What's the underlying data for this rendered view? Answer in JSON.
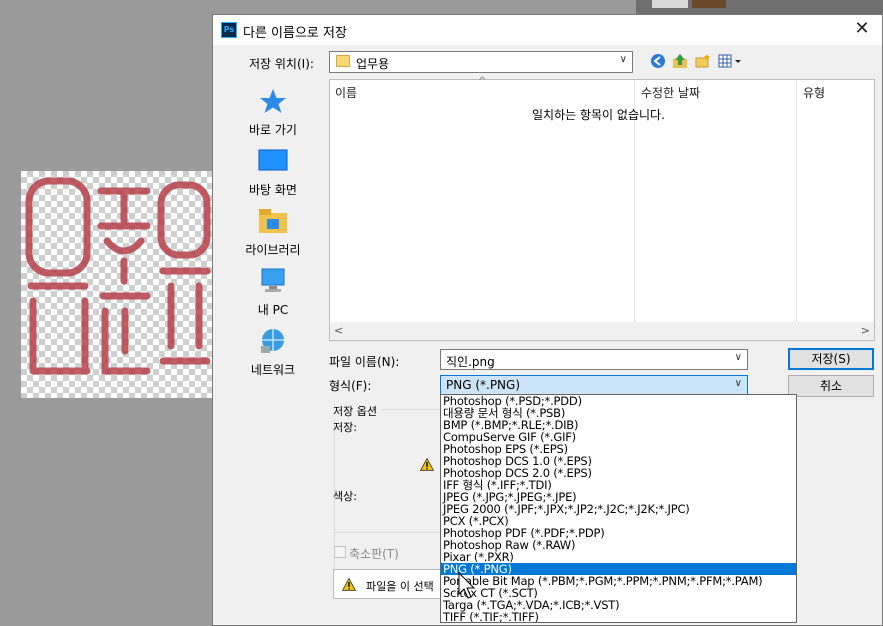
{
  "dialog": {
    "app_icon": "photoshop-icon",
    "title": "다른 이름으로 저장",
    "close_glyph": "✕"
  },
  "location": {
    "label": "저장 위치(I):",
    "value": "업무용"
  },
  "places": [
    {
      "name": "quick-access",
      "icon": "star-icon",
      "label": "바로 가기"
    },
    {
      "name": "desktop",
      "icon": "desktop-icon",
      "label": "바탕 화면"
    },
    {
      "name": "libraries",
      "icon": "library-icon",
      "label": "라이브러리"
    },
    {
      "name": "this-pc",
      "icon": "computer-icon",
      "label": "내 PC"
    },
    {
      "name": "network",
      "icon": "network-icon",
      "label": "네트워크"
    }
  ],
  "filelist": {
    "columns": [
      "이름",
      "수정한 날짜",
      "유형"
    ],
    "empty_message": "일치하는 항목이 없습니다."
  },
  "filename": {
    "label": "파일 이름(N):",
    "value": "직인.png"
  },
  "format": {
    "label": "형식(F):",
    "selected": "PNG (*.PNG)",
    "options": [
      "Photoshop (*.PSD;*.PDD)",
      "대용량 문서 형식 (*.PSB)",
      "BMP (*.BMP;*.RLE;*.DIB)",
      "CompuServe GIF (*.GIF)",
      "Photoshop EPS (*.EPS)",
      "Photoshop DCS 1.0 (*.EPS)",
      "Photoshop DCS 2.0 (*.EPS)",
      "IFF 형식 (*.IFF;*.TDI)",
      "JPEG (*.JPG;*.JPEG;*.JPE)",
      "JPEG 2000 (*.JPF;*.JPX;*.JP2;*.J2C;*.J2K;*.JPC)",
      "PCX (*.PCX)",
      "Photoshop PDF (*.PDF;*.PDP)",
      "Photoshop Raw (*.RAW)",
      "Pixar (*.PXR)",
      "PNG (*.PNG)",
      "Portable Bit Map (*.PBM;*.PGM;*.PPM;*.PNM;*.PFM;*.PAM)",
      "Scitex CT (*.SCT)",
      "Targa (*.TGA;*.VDA;*.ICB;*.VST)",
      "TIFF (*.TIF;*.TIFF)"
    ],
    "selected_index": 14
  },
  "buttons": {
    "save": "저장(S)",
    "cancel": "취소"
  },
  "save_options": {
    "group_title": "저장 옵션",
    "save_label": "저장:",
    "color_label": "색상:",
    "thumbnail_label": "축소판(T)",
    "info_text": "파일을 이 선택"
  },
  "colors": {
    "selection": "#0078d7",
    "combo_focus": "#cce4f7",
    "stamp_red": "#b5404a"
  }
}
